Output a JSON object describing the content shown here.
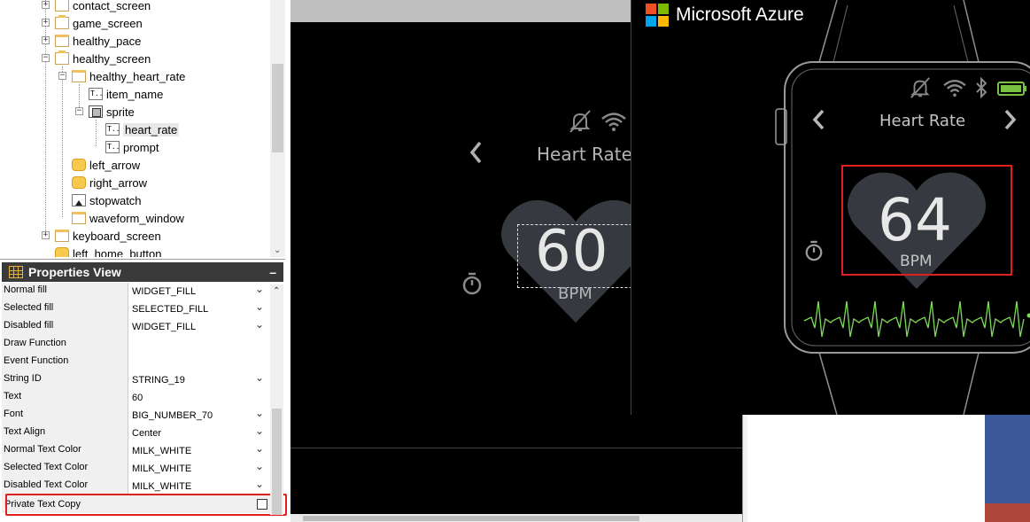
{
  "tree": {
    "items": [
      {
        "label": "contact_screen",
        "icon": "folder-doc"
      },
      {
        "label": "game_screen",
        "icon": "folder-doc"
      },
      {
        "label": "healthy_pace",
        "icon": "page"
      },
      {
        "label": "healthy_screen",
        "icon": "folder-doc"
      },
      {
        "label": "healthy_heart_rate",
        "icon": "page"
      },
      {
        "label": "item_name",
        "icon": "text"
      },
      {
        "label": "sprite",
        "icon": "sprite"
      },
      {
        "label": "heart_rate",
        "icon": "text"
      },
      {
        "label": "prompt",
        "icon": "text"
      },
      {
        "label": "left_arrow",
        "icon": "pill"
      },
      {
        "label": "right_arrow",
        "icon": "pill"
      },
      {
        "label": "stopwatch",
        "icon": "image"
      },
      {
        "label": "waveform_window",
        "icon": "page"
      },
      {
        "label": "keyboard_screen",
        "icon": "page"
      },
      {
        "label": "left_home_button",
        "icon": "pill"
      }
    ],
    "expanders": [
      "+",
      "+",
      "+",
      "−",
      "−",
      "−",
      "+"
    ]
  },
  "properties": {
    "title": "Properties View",
    "minimize": "–",
    "rows": [
      {
        "name": "Normal fill",
        "value": "WIDGET_FILL",
        "combo": true
      },
      {
        "name": "Selected fill",
        "value": "SELECTED_FILL",
        "combo": true
      },
      {
        "name": "Disabled fill",
        "value": "WIDGET_FILL",
        "combo": true
      },
      {
        "name": "Draw Function",
        "value": "",
        "combo": false
      },
      {
        "name": "Event Function",
        "value": "",
        "combo": false
      },
      {
        "name": "String ID",
        "value": "STRING_19",
        "combo": true
      },
      {
        "name": "Text",
        "value": "60",
        "combo": false
      },
      {
        "name": "Font",
        "value": "BIG_NUMBER_70",
        "combo": true
      },
      {
        "name": "Text Align",
        "value": "Center",
        "combo": true
      },
      {
        "name": "Normal Text Color",
        "value": "MILK_WHITE",
        "combo": true
      },
      {
        "name": "Selected Text Color",
        "value": "MILK_WHITE",
        "combo": true
      },
      {
        "name": "Disabled Text Color",
        "value": "MILK_WHITE",
        "combo": true
      }
    ],
    "private_text_copy": {
      "name": "Private Text Copy",
      "checked": false
    }
  },
  "designer": {
    "title": "Heart Rate",
    "value": "60",
    "unit": "BPM"
  },
  "azure": {
    "brand": "Microsoft Azure",
    "logo_colors": [
      "#f25022",
      "#7fba00",
      "#00a4ef",
      "#ffb900"
    ],
    "title": "Heart Rate",
    "value": "64",
    "unit": "BPM"
  },
  "colors": {
    "highlight": "#e0201e",
    "waveform": "#7ed957",
    "battery": "#79c23f",
    "heart": "#363a40"
  }
}
